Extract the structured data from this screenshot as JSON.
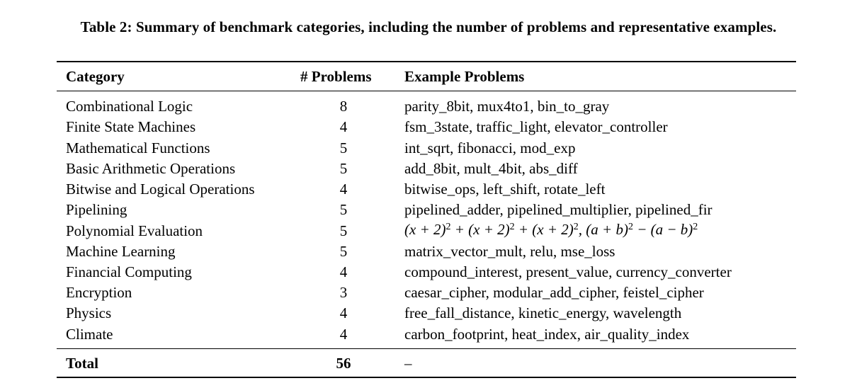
{
  "caption": "Table 2: Summary of benchmark categories, including the number of problems and representative examples.",
  "table": {
    "headers": [
      "Category",
      "# Problems",
      "Example Problems"
    ],
    "rows": [
      {
        "category": "Combinational Logic",
        "count": "8",
        "examples": "parity_8bit, mux4to1, bin_to_gray"
      },
      {
        "category": "Finite State Machines",
        "count": "4",
        "examples": "fsm_3state, traffic_light, elevator_controller"
      },
      {
        "category": "Mathematical Functions",
        "count": "5",
        "examples": "int_sqrt, fibonacci, mod_exp"
      },
      {
        "category": "Basic Arithmetic Operations",
        "count": "5",
        "examples": "add_8bit, mult_4bit, abs_diff"
      },
      {
        "category": "Bitwise and Logical Operations",
        "count": "4",
        "examples": "bitwise_ops, left_shift, rotate_left"
      },
      {
        "category": "Pipelining",
        "count": "5",
        "examples": "pipelined_adder, pipelined_multiplier, pipelined_fir"
      },
      {
        "category": "Polynomial Evaluation",
        "count": "5",
        "examples": "(x + 2)^2 + (x + 2)^2 + (x + 2)^2, (a + b)^2 − (a − b)^2"
      },
      {
        "category": "Machine Learning",
        "count": "5",
        "examples": "matrix_vector_mult, relu, mse_loss"
      },
      {
        "category": "Financial Computing",
        "count": "4",
        "examples": "compound_interest, present_value, currency_converter"
      },
      {
        "category": "Encryption",
        "count": "3",
        "examples": "caesar_cipher, modular_add_cipher, feistel_cipher"
      },
      {
        "category": "Physics",
        "count": "4",
        "examples": "free_fall_distance, kinetic_energy, wavelength"
      },
      {
        "category": "Climate",
        "count": "4",
        "examples": "carbon_footprint, heat_index, air_quality_index"
      }
    ],
    "total": {
      "label": "Total",
      "count": "56",
      "examples": "–"
    }
  }
}
